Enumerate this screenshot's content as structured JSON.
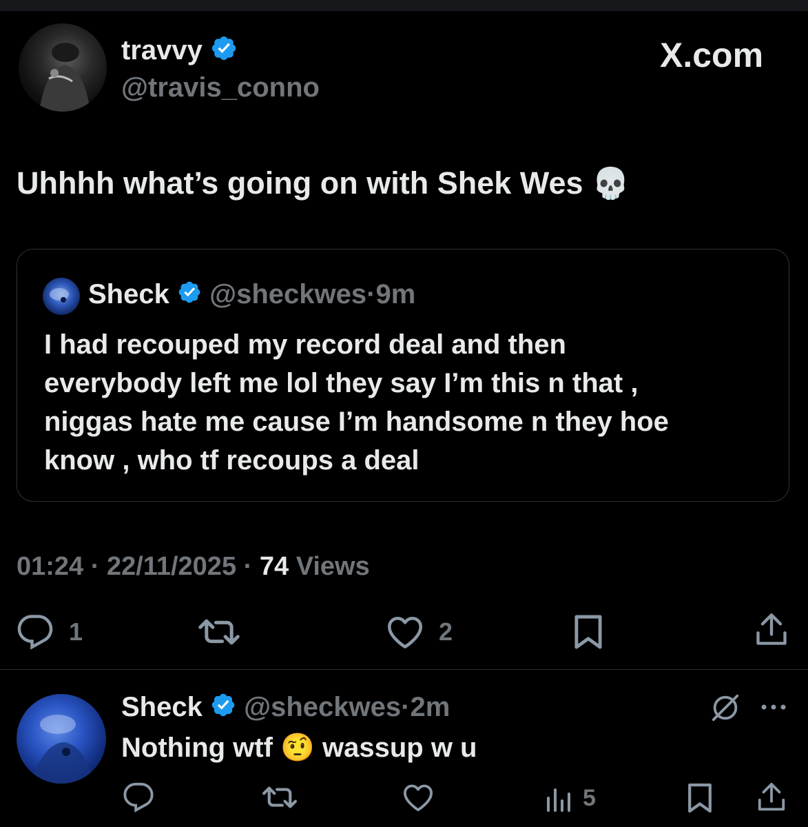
{
  "main_tweet": {
    "author_name": "travvy",
    "author_handle": "@travis_conno",
    "site_label": "X.com",
    "text": "Uhhhh what’s going on with Shek Wes",
    "emoji": "💀",
    "time": "01:24",
    "date": "22/11/2025",
    "views_count": "74",
    "views_label": "Views",
    "reply_count": "1",
    "like_count": "2"
  },
  "quoted_tweet": {
    "author_name": "Sheck",
    "author_handle": "@sheckwes",
    "age": "9m",
    "lines": [
      "I had recouped my record deal and then",
      "everybody left me lol they say I’m this n that ,",
      "niggas hate me cause I’m handsome n they hoe",
      "know , who tf recoups a deal"
    ]
  },
  "reply": {
    "author_name": "Sheck",
    "author_handle": "@sheckwes",
    "age": "2m",
    "text_before": "Nothing wtf",
    "emoji": "🤨",
    "text_after": "wassup w u",
    "views_count": "5"
  },
  "colors": {
    "background": "#000000",
    "text_primary": "#e7e9ea",
    "text_secondary": "#71767b",
    "verified_blue": "#1d9bf0",
    "border": "#2f3336"
  },
  "icons": [
    "verified-badge-icon",
    "reply-icon",
    "retweet-icon",
    "like-icon",
    "bookmark-icon",
    "share-icon",
    "views-icon",
    "grok-icon",
    "more-icon",
    "skull-emoji",
    "raised-eyebrow-emoji"
  ]
}
